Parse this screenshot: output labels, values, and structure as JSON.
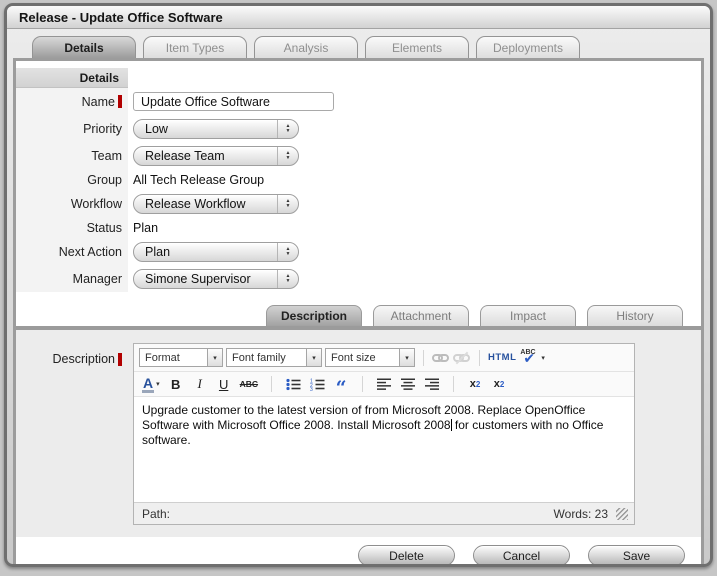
{
  "window": {
    "title": "Release - Update Office Software"
  },
  "main_tabs": {
    "items": [
      {
        "label": "Details"
      },
      {
        "label": "Item Types"
      },
      {
        "label": "Analysis"
      },
      {
        "label": "Elements"
      },
      {
        "label": "Deployments"
      }
    ]
  },
  "details_form": {
    "header": "Details",
    "fields": {
      "name": {
        "label": "Name",
        "value": "Update Office Software"
      },
      "priority": {
        "label": "Priority",
        "value": "Low"
      },
      "team": {
        "label": "Team",
        "value": "Release Team"
      },
      "group": {
        "label": "Group",
        "value": "All Tech Release Group"
      },
      "workflow": {
        "label": "Workflow",
        "value": "Release Workflow"
      },
      "status": {
        "label": "Status",
        "value": "Plan"
      },
      "next_action": {
        "label": "Next Action",
        "value": "Plan"
      },
      "manager": {
        "label": "Manager",
        "value": "Simone Supervisor"
      }
    }
  },
  "sub_tabs": {
    "items": [
      {
        "label": "Description"
      },
      {
        "label": "Attachment"
      },
      {
        "label": "Impact"
      },
      {
        "label": "History"
      }
    ]
  },
  "editor": {
    "label": "Description",
    "toolbar": {
      "format_select": "Format",
      "font_family_select": "Font family",
      "font_size_select": "Font size",
      "html_button": "HTML",
      "spellcheck_letters": "ABC",
      "forecolor_letter": "A",
      "bold": "B",
      "italic": "I",
      "underline": "U",
      "strikethrough": "ABC",
      "blockquote": "“",
      "subscript_base": "x",
      "subscript_digit": "2",
      "superscript_base": "x",
      "superscript_digit": "2"
    },
    "content_before_caret": "Upgrade customer to the latest version of from Microsoft 2008. Replace OpenOffice Software with Microsoft Office 2008. Install Microsoft 2008",
    "content_after_caret": " for customers with no Office software.",
    "status_bar": {
      "path_label": "Path:",
      "words_label": "Words: 23"
    }
  },
  "footer": {
    "buttons": [
      {
        "label": "Delete"
      },
      {
        "label": "Cancel"
      },
      {
        "label": "Save"
      }
    ]
  },
  "icons": {
    "stepper_up": "▲",
    "stepper_down": "▼",
    "dropdown_arrow": "▾",
    "spell_check": "✔"
  },
  "colors": {
    "required_marker": "#b20000",
    "accent_blue": "#2b5cc4"
  }
}
